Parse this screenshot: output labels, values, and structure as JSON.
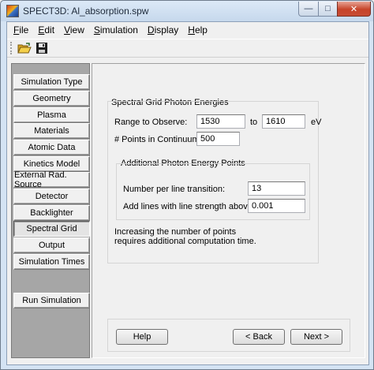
{
  "window": {
    "title": "SPECT3D:  Al_absorption.spw",
    "minimize_glyph": "—",
    "maximize_glyph": "□",
    "close_glyph": "✕"
  },
  "menu": [
    {
      "label": "File",
      "u": "F",
      "rest": "ile"
    },
    {
      "label": "Edit",
      "u": "E",
      "rest": "dit"
    },
    {
      "label": "View",
      "u": "V",
      "rest": "iew"
    },
    {
      "label": "Simulation",
      "u": "S",
      "rest": "imulation"
    },
    {
      "label": "Display",
      "u": "D",
      "rest": "isplay"
    },
    {
      "label": "Help",
      "u": "H",
      "rest": "elp"
    }
  ],
  "toolbar": {
    "open_icon": "open-folder-icon",
    "save_icon": "save-disk-icon"
  },
  "sidebar": {
    "items": [
      {
        "label": "Simulation Type"
      },
      {
        "label": "Geometry"
      },
      {
        "label": "Plasma"
      },
      {
        "label": "Materials"
      },
      {
        "label": "Atomic Data"
      },
      {
        "label": "Kinetics Model"
      },
      {
        "label": "External Rad. Source"
      },
      {
        "label": "Detector"
      },
      {
        "label": "Backlighter"
      },
      {
        "label": "Spectral Grid",
        "active": true
      },
      {
        "label": "Output"
      },
      {
        "label": "Simulation Times"
      }
    ],
    "run_label": "Run Simulation"
  },
  "spectral": {
    "group_title": "Spectral Grid Photon Energies",
    "range_label": "Range to Observe:",
    "range_from": "1530",
    "range_to_label": "to",
    "range_to": "1610",
    "unit": "eV",
    "points_label": "# Points in Continuum:",
    "points_value": "500",
    "additional": {
      "title": "Additional Photon Energy Points",
      "per_line_label": "Number per line transition:",
      "per_line_value": "13",
      "strength_label": "Add lines with line strength above:",
      "strength_value": "0.001"
    },
    "note_line1": "Increasing the number of points",
    "note_line2": "requires additional computation time."
  },
  "buttons": {
    "help": "Help",
    "back": "< Back",
    "next": "Next >"
  }
}
